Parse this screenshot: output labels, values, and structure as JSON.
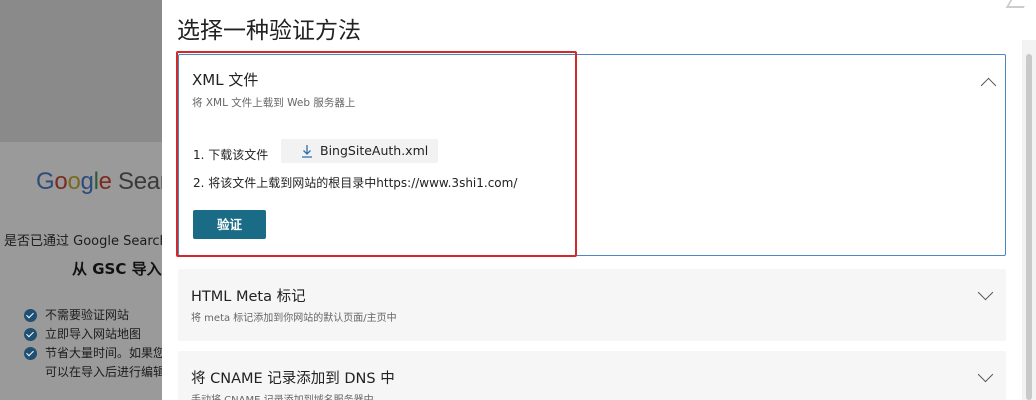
{
  "background": {
    "logo_parts": [
      "G",
      "o",
      "o",
      "g",
      "l",
      "e",
      " Sear"
    ],
    "question": "是否已通过 Google Search",
    "heading": "从 GSC 导入",
    "benefits": [
      "不需要验证网站",
      "立即导入网站地图",
      "节省大量时间。如果您"
    ],
    "benefit_continuation": "可以在导入后进行编辑"
  },
  "panel": {
    "title": "选择一种验证方法",
    "xml": {
      "title": "XML 文件",
      "subtitle": "将 XML 文件上载到 Web 服务器上",
      "step1": "1. 下载该文件",
      "download_file": "BingSiteAuth.xml",
      "step2": "2. 将该文件上载到网站的根目录中https://www.3shi1.com/",
      "verify_button": "验证",
      "expand_icon": "chevron-up-icon"
    },
    "meta": {
      "title": "HTML Meta 标记",
      "subtitle": "将 meta 标记添加到你网站的默认页面/主页中",
      "expand_icon": "chevron-down-icon"
    },
    "cname": {
      "title": "将 CNAME 记录添加到 DNS 中",
      "subtitle": "手动将 CNAME 记录添加到域名服务器中",
      "expand_icon": "chevron-down-icon"
    }
  },
  "colors": {
    "accent": "#1a6b85",
    "active_border": "#4b87c5",
    "highlight_frame": "#d12a2a"
  }
}
